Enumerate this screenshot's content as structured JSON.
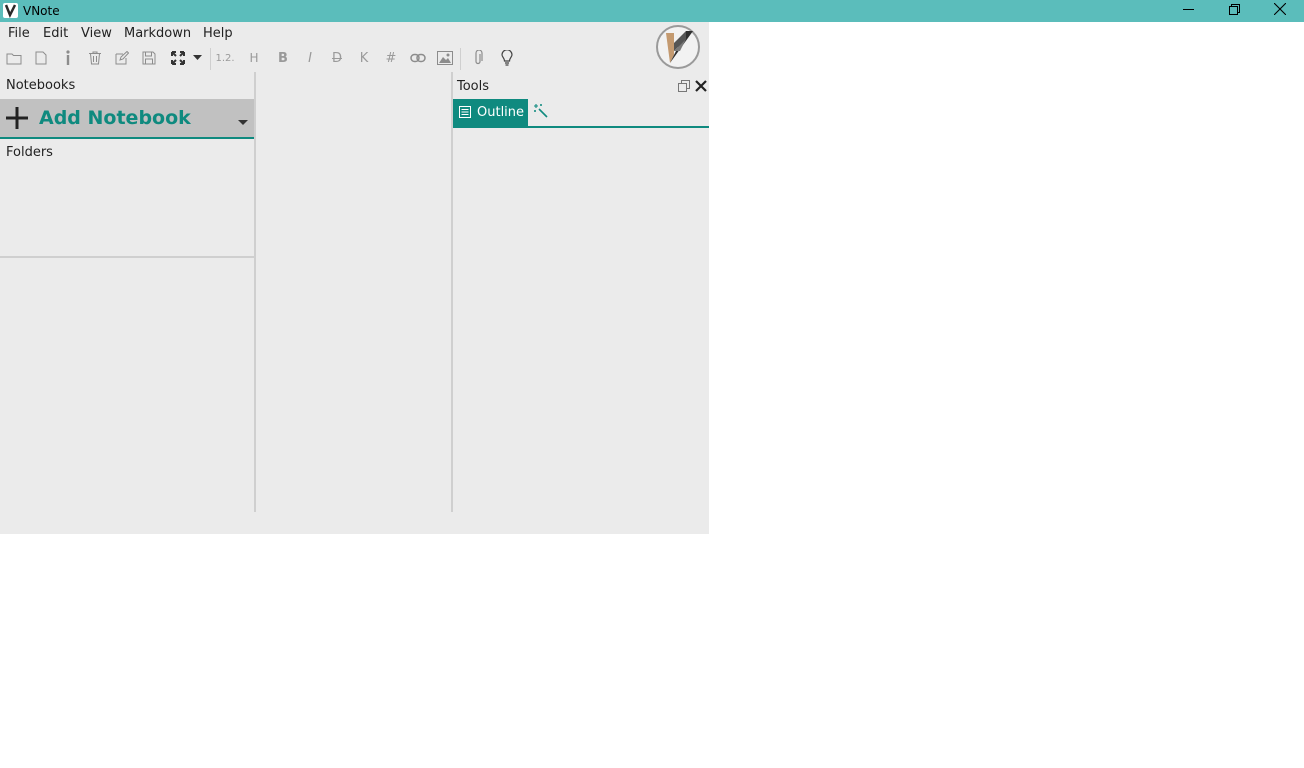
{
  "window": {
    "title": "VNote",
    "app_icon": "vnote-icon",
    "controls": [
      "minimize-icon",
      "restore-icon",
      "close-icon"
    ]
  },
  "menu": {
    "items": [
      "File",
      "Edit",
      "View",
      "Markdown",
      "Help"
    ]
  },
  "toolbar": {
    "icons": [
      "new-notebook-icon",
      "new-note-icon",
      "info-icon",
      "delete-icon",
      "edit-icon",
      "save-icon",
      "fullscreen-icon",
      "dropdown-icon"
    ],
    "heading_sequence": "1.2.",
    "heading": "H",
    "bold": "B",
    "italic": "I",
    "strikethrough": "D",
    "inline_code": "K",
    "hash": "#",
    "format_icons": [
      "link-icon",
      "image-icon",
      "attachment-icon",
      "lightbulb-icon"
    ]
  },
  "notebook_pane": {
    "title": "Notebooks",
    "add_notebook": "Add Notebook",
    "folders_label": "Folders"
  },
  "tools_pane": {
    "title": "Tools",
    "tabs": [
      "Outline"
    ]
  },
  "colors": {
    "titlebar": "#5bbdbb",
    "accent": "#0f8a7f",
    "pane_bg": "#ebebeb",
    "add_notebook_bg": "#c1c1c1"
  }
}
